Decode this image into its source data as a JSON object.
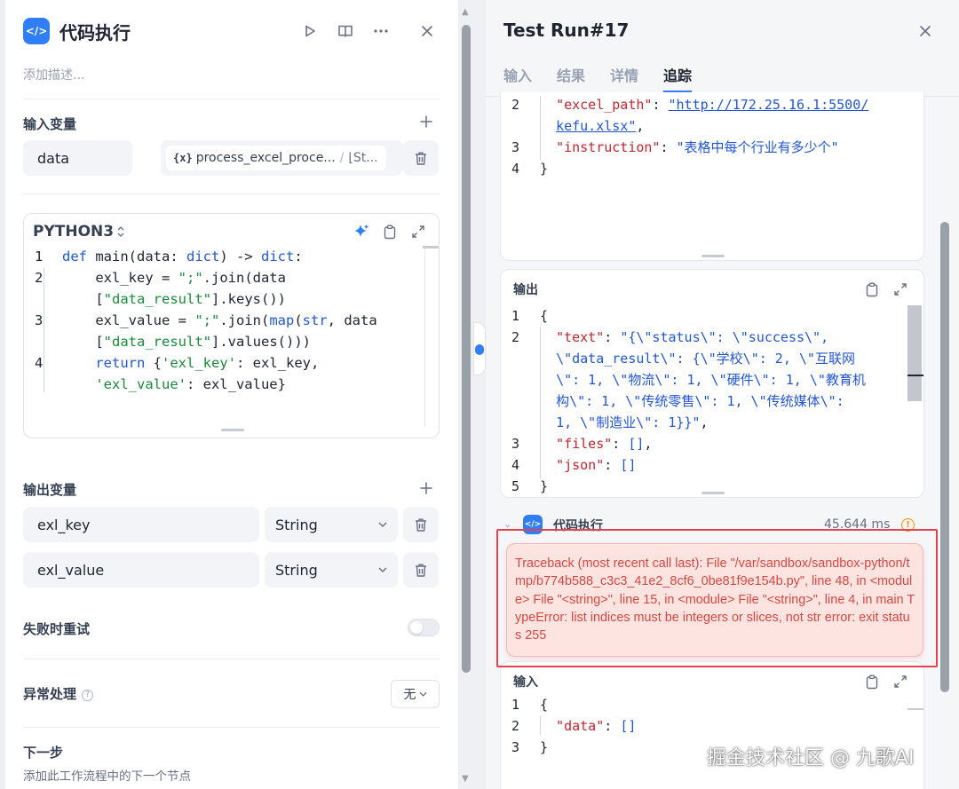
{
  "node": {
    "title": "代码执行",
    "description_placeholder": "添加描述...",
    "icon_glyph": "</>"
  },
  "inputs": {
    "title": "输入变量",
    "items": [
      {
        "name": "data",
        "ref_icon": "{x}",
        "ref_node": "process_excel_proce...",
        "ref_sep": "/",
        "ref_var": "⌊St..."
      }
    ]
  },
  "code_editor": {
    "language": "PYTHON3",
    "lines": [
      {
        "ln": "1",
        "html": "<span class=\"kw\">def</span> main(data: <span class=\"kw\">dict</span>) -> <span class=\"kw\">dict</span>:"
      },
      {
        "ln": "2",
        "html": "    exl_key = <span class=\"st\">\";\"</span>.join(data"
      },
      {
        "ln": "",
        "html": "    [<span class=\"st\">\"data_result\"</span>].keys())"
      },
      {
        "ln": "3",
        "html": "    exl_value = <span class=\"st\">\";\"</span>.join(<span class=\"kw\">map</span>(<span class=\"kw\">str</span>, data"
      },
      {
        "ln": "",
        "html": "    [<span class=\"st\">\"data_result\"</span>].values()))"
      },
      {
        "ln": "4",
        "html": "    <span class=\"kw\">return</span> {<span class=\"st\">'exl_key'</span>: exl_key,"
      },
      {
        "ln": "",
        "html": "    <span class=\"st\">'exl_value'</span>: exl_value}"
      }
    ]
  },
  "outputs": {
    "title": "输出变量",
    "items": [
      {
        "name": "exl_key",
        "type": "String"
      },
      {
        "name": "exl_value",
        "type": "String"
      }
    ]
  },
  "retry": {
    "label": "失败时重试",
    "enabled": false
  },
  "error_handling": {
    "label": "异常处理",
    "value": "无"
  },
  "next_step": {
    "title": "下一步",
    "subtitle": "添加此工作流程中的下一个节点"
  },
  "run": {
    "title": "Test Run#17",
    "tabs": [
      {
        "label": "输入",
        "active": false
      },
      {
        "label": "结果",
        "active": false
      },
      {
        "label": "详情",
        "active": false
      },
      {
        "label": "追踪",
        "active": true
      }
    ],
    "top_code": [
      {
        "ln": "2",
        "html": "  <span class=\"key\">\"excel_path\"</span>: <span class=\"str url\">\"http://172.25.16.1:5500/</span>"
      },
      {
        "ln": "",
        "html": "  <span class=\"str url\">kefu.xlsx\"</span>,"
      },
      {
        "ln": "3",
        "html": "  <span class=\"key\">\"instruction\"</span>: <span class=\"str\">\"表格中每个行业有多少个\"</span>"
      },
      {
        "ln": "4",
        "html": "}"
      }
    ],
    "output_card": {
      "title": "输出",
      "lines": [
        {
          "ln": "1",
          "html": "{"
        },
        {
          "ln": "2",
          "html": "  <span class=\"key\">\"text\"</span>: <span class=\"str\">\"{\\\"status\\\": \\\"success\\\",</span>"
        },
        {
          "ln": "",
          "html": "  <span class=\"str\">\\\"data_result\\\": {\\\"学校\\\": 2, \\\"互联网</span>"
        },
        {
          "ln": "",
          "html": "  <span class=\"str\">\\\": 1, \\\"物流\\\": 1, \\\"硬件\\\": 1, \\\"教育机</span>"
        },
        {
          "ln": "",
          "html": "  <span class=\"str\">构\\\": 1, \\\"传统零售\\\": 1, \\\"传统媒体\\\":</span>"
        },
        {
          "ln": "",
          "html": "  <span class=\"str\">1, \\\"制造业\\\": 1}}\"</span>,"
        },
        {
          "ln": "3",
          "html": "  <span class=\"key\">\"files\"</span>: <span class=\"str\">[]</span>,"
        },
        {
          "ln": "4",
          "html": "  <span class=\"key\">\"json\"</span>: <span class=\"str\">[]</span>"
        },
        {
          "ln": "5",
          "html": "}"
        }
      ]
    },
    "exec_node": {
      "label": "代码执行",
      "duration": "45.644 ms",
      "error": "Traceback (most recent call last): File \"/var/sandbox/sandbox-python/tmp/b774b588_c3c3_41e2_8cf6_0be81f9e154b.py\", line 48, in <module> File \"<string>\", line 15, in <module> File \"<string>\", line 4, in main TypeError: list indices must be integers or slices, not str error: exit status 255"
    },
    "input_card": {
      "title": "输入",
      "lines": [
        {
          "ln": "1",
          "html": "{"
        },
        {
          "ln": "2",
          "html": "  <span class=\"key\">\"data\"</span>: <span class=\"str\">[]</span>"
        },
        {
          "ln": "3",
          "html": "}"
        }
      ]
    }
  },
  "watermark": "掘金技术社区 @ 九歌AI",
  "colors": {
    "accent": "#2f7ef6",
    "error_text": "#d9463f",
    "error_bg": "#fde4e1",
    "error_outline": "#e8414f"
  }
}
